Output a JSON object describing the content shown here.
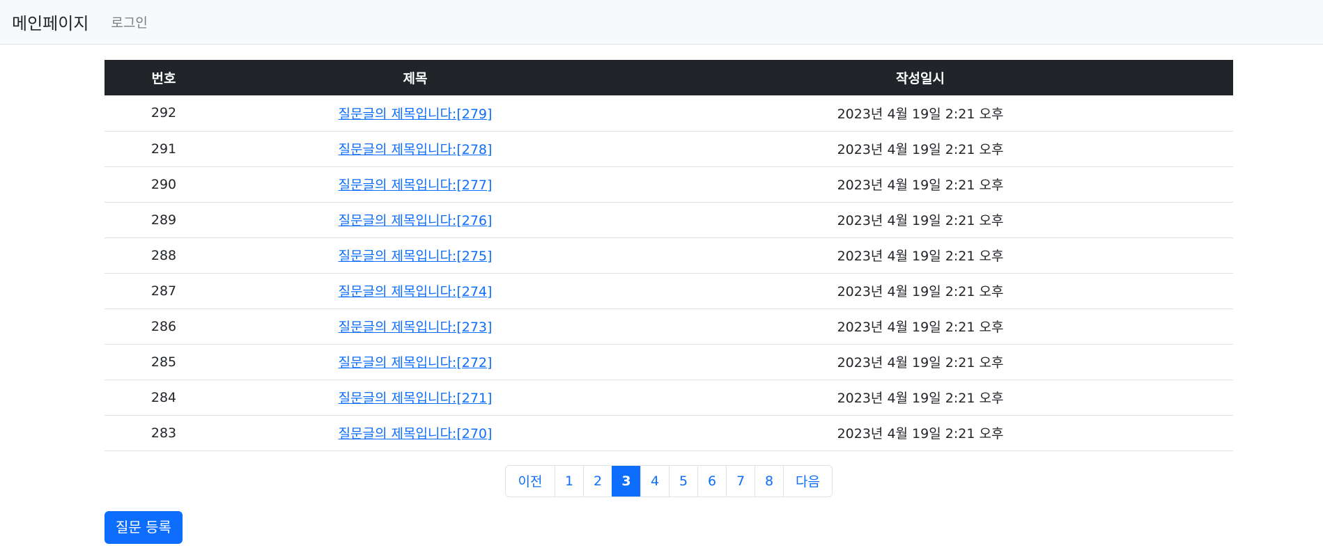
{
  "navbar": {
    "brand": "메인페이지",
    "login": "로그인"
  },
  "table": {
    "headers": [
      "번호",
      "제목",
      "작성일시"
    ],
    "rows": [
      {
        "num": "292",
        "title": "질문글의 제목입니다:[279]",
        "date": "2023년 4월 19일 2:21 오후"
      },
      {
        "num": "291",
        "title": "질문글의 제목입니다:[278]",
        "date": "2023년 4월 19일 2:21 오후"
      },
      {
        "num": "290",
        "title": "질문글의 제목입니다:[277]",
        "date": "2023년 4월 19일 2:21 오후"
      },
      {
        "num": "289",
        "title": "질문글의 제목입니다:[276]",
        "date": "2023년 4월 19일 2:21 오후"
      },
      {
        "num": "288",
        "title": "질문글의 제목입니다:[275]",
        "date": "2023년 4월 19일 2:21 오후"
      },
      {
        "num": "287",
        "title": "질문글의 제목입니다:[274]",
        "date": "2023년 4월 19일 2:21 오후"
      },
      {
        "num": "286",
        "title": "질문글의 제목입니다:[273]",
        "date": "2023년 4월 19일 2:21 오후"
      },
      {
        "num": "285",
        "title": "질문글의 제목입니다:[272]",
        "date": "2023년 4월 19일 2:21 오후"
      },
      {
        "num": "284",
        "title": "질문글의 제목입니다:[271]",
        "date": "2023년 4월 19일 2:21 오후"
      },
      {
        "num": "283",
        "title": "질문글의 제목입니다:[270]",
        "date": "2023년 4월 19일 2:21 오후"
      }
    ]
  },
  "pagination": {
    "prev": "이전",
    "pages": [
      "1",
      "2",
      "3",
      "4",
      "5",
      "6",
      "7",
      "8"
    ],
    "active": "3",
    "next": "다음"
  },
  "actions": {
    "register": "질문 등록"
  },
  "colors": {
    "primary": "#0d6efd",
    "header_bg": "#212529",
    "navbar_bg": "#f8f9fa"
  }
}
